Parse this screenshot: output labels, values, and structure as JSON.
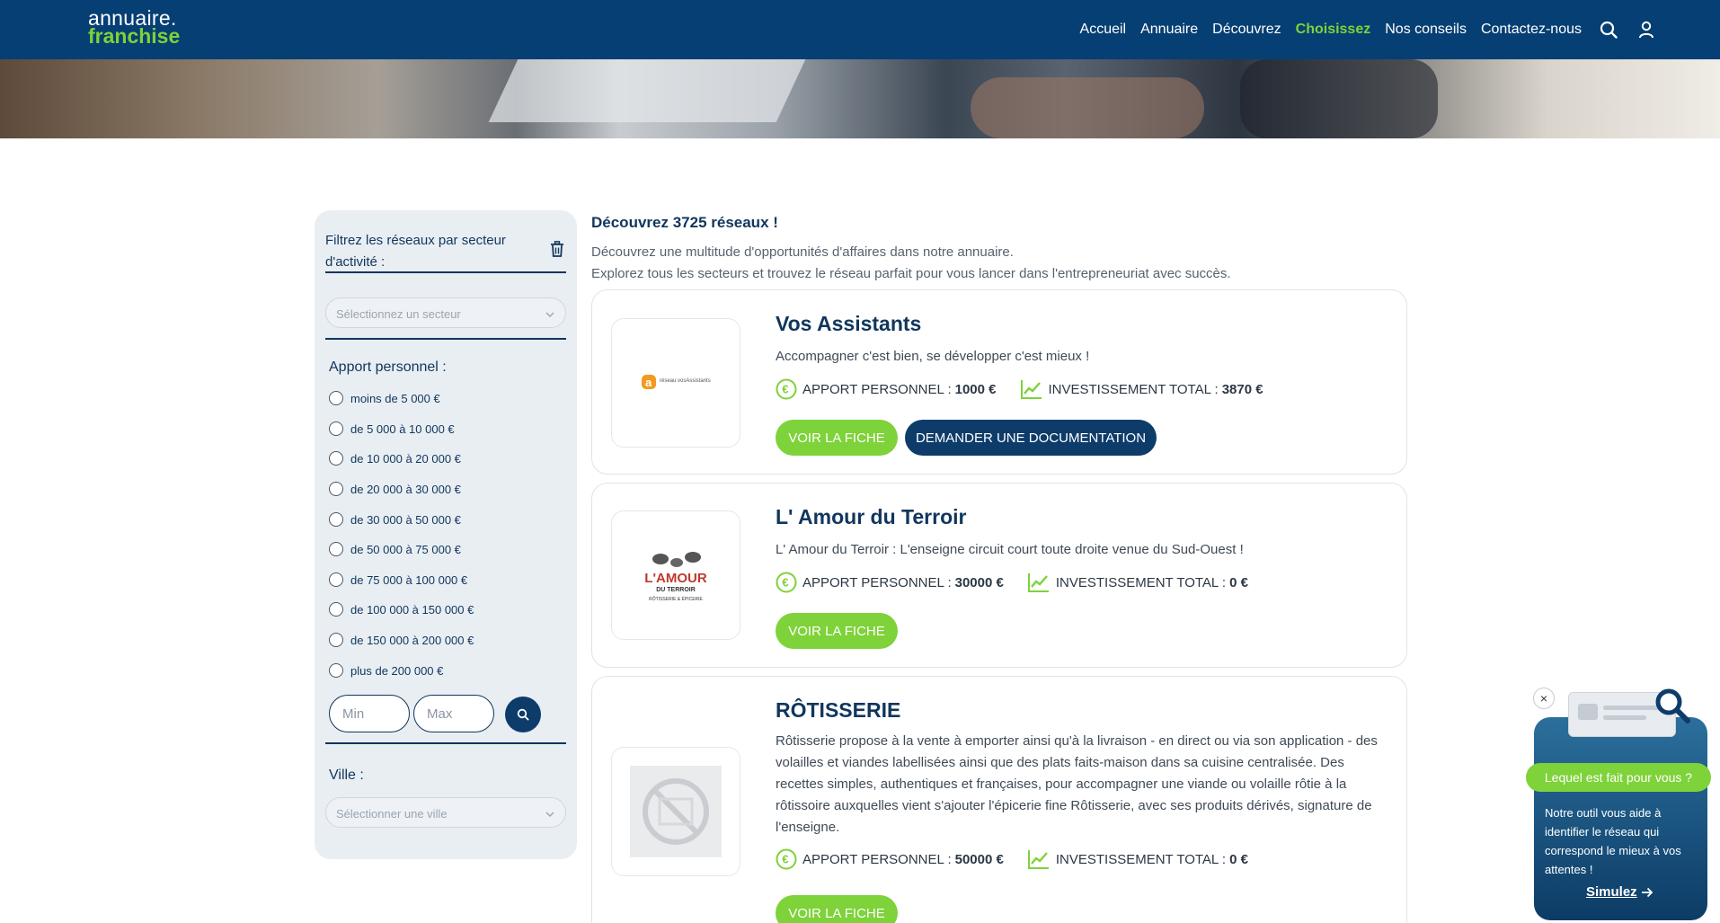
{
  "header": {
    "logo_line1": "annuaire.",
    "logo_line2": "franchise",
    "nav": [
      "Accueil",
      "Annuaire",
      "Découvrez",
      "Choisissez",
      "Nos conseils",
      "Contactez-nous"
    ],
    "active_nav": "Choisissez",
    "icons": [
      "search-icon",
      "user-icon"
    ]
  },
  "sidebar": {
    "title": "Filtrez les réseaux par secteur d'activité :",
    "sector_placeholder": "Sélectionnez un secteur",
    "apport_label": "Apport personnel :",
    "apport_options": [
      "moins de 5 000 €",
      "de 5 000 à 10 000 €",
      "de 10 000 à 20 000 €",
      "de 20 000 à 30 000 €",
      "de 30 000 à 50 000 €",
      "de 50 000 à 75 000 €",
      "de 75 000 à 100 000 €",
      "de 100 000 à 150 000 €",
      "de 150 000 à 200 000 €",
      "plus de 200 000 €"
    ],
    "min_placeholder": "Min",
    "max_placeholder": "Max",
    "city_label": "Ville :",
    "city_placeholder": "Sélectionner une ville"
  },
  "main": {
    "title": "Découvrez 3725 réseaux !",
    "desc_line1": "Découvrez une multitude d'opportunités d'affaires dans notre annuaire.",
    "desc_line2": "Explorez tous les secteurs et trouvez le réseau parfait pour vous lancer dans l'entrepreneuriat avec succès."
  },
  "cards": [
    {
      "name": "Vos Assistants",
      "tagline": "Accompagner c'est bien, se développer c'est mieux !",
      "apport_label": "APPORT PERSONNEL :",
      "apport_value": "1000 €",
      "invest_label": "INVESTISSEMENT TOTAL :",
      "invest_value": "3870 €",
      "btn_fiche": "VOIR LA FICHE",
      "btn_doc": "DEMANDER UNE DOCUMENTATION",
      "logo_text": "réseau vosAssistants"
    },
    {
      "name": "L' Amour du Terroir",
      "tagline": "L' Amour du Terroir : L'enseigne circuit court toute droite venue du Sud-Ouest !",
      "apport_label": "APPORT PERSONNEL :",
      "apport_value": "30000 €",
      "invest_label": "INVESTISSEMENT TOTAL :",
      "invest_value": "0 €",
      "btn_fiche": "VOIR LA FICHE",
      "logo_line1": "L'AMOUR",
      "logo_line2": "DU TERROIR",
      "logo_line3": "RÔTISSERIE & ÉPICERIE"
    },
    {
      "name": "RÔTISSERIE",
      "tagline": "Rôtisserie propose à la vente à emporter ainsi qu'à la livraison - en direct ou via son application - des volailles et viandes labellisées ainsi que des plats faits-maison dans sa cuisine centralisée. Des recettes simples, authentiques et françaises, pour accompagner une viande ou volaille rôtie à la rôtissoire auxquelles vient s'ajouter l'épicerie fine Rôtisserie, avec ses produits dérivés, signature de l'enseigne.",
      "apport_label": "APPORT PERSONNEL :",
      "apport_value": "50000 €",
      "invest_label": "INVESTISSEMENT TOTAL :",
      "invest_value": "0 €",
      "btn_fiche": "VOIR LA FICHE"
    }
  ],
  "widget": {
    "close": "×",
    "pill": "Lequel est fait pour vous ?",
    "text": "Notre outil vous aide à identifier le réseau qui correspond le mieux à vos attentes !",
    "link": "Simulez"
  },
  "colors": {
    "header_bg": "#063f73",
    "accent_green": "#7ed23a",
    "navy": "#0e3c6a",
    "text_dark": "#10365d"
  }
}
